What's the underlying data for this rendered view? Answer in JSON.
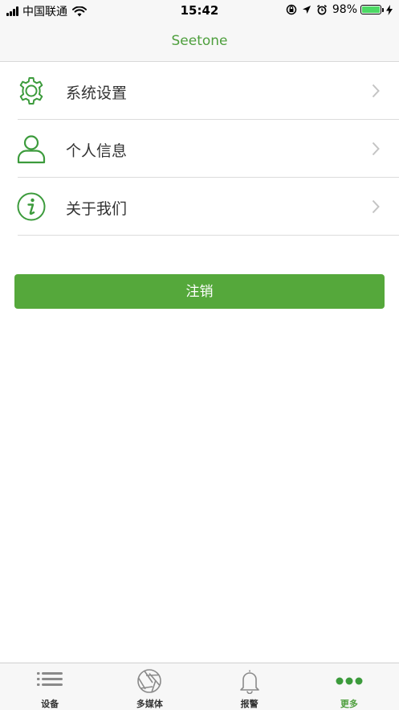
{
  "status_bar": {
    "carrier": "中国联通",
    "time": "15:42",
    "battery": "98%",
    "battery_level": 0.98
  },
  "nav": {
    "title": "Seetone"
  },
  "menu": {
    "items": [
      {
        "label": "系统设置",
        "icon": "gear-icon"
      },
      {
        "label": "个人信息",
        "icon": "user-icon"
      },
      {
        "label": "关于我们",
        "icon": "info-icon"
      }
    ]
  },
  "logout": {
    "label": "注销"
  },
  "tabs": [
    {
      "label": "设备",
      "icon": "device-list-icon",
      "active": false
    },
    {
      "label": "多媒体",
      "icon": "aperture-icon",
      "active": false
    },
    {
      "label": "报警",
      "icon": "bell-icon",
      "active": false
    },
    {
      "label": "更多",
      "icon": "more-dots-icon",
      "active": true
    }
  ],
  "colors": {
    "accent": "#4e9f3d",
    "button": "#55a83b",
    "tab_inactive": "#8a8a8a"
  }
}
